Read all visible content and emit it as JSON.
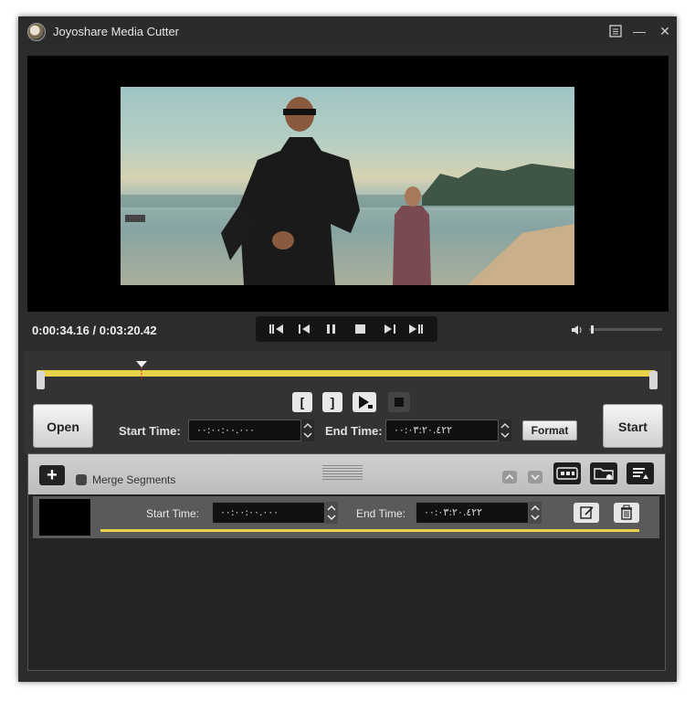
{
  "window": {
    "title": "Joyoshare Media Cutter"
  },
  "titlebar": {
    "icons": [
      "menu-icon",
      "minimize-icon",
      "close-icon"
    ],
    "minimize_glyph": "—",
    "close_glyph": "✕"
  },
  "player": {
    "current_time": "0:00:34.16",
    "total_time": "0:03:20.42",
    "time_separator": " / ",
    "playback_buttons": [
      "frame-back-icon",
      "step-back-icon",
      "pause-icon",
      "stop-icon",
      "step-forward-icon",
      "frame-forward-icon"
    ],
    "volume_level": 0.02
  },
  "editor": {
    "playhead_fraction": 0.17,
    "mark_start": "[",
    "mark_end": "]",
    "open_label": "Open",
    "start_label": "Start",
    "start_time_label": "Start Time:",
    "start_time_value": "٠٠:٠٠:٠٠.٠٠٠",
    "end_time_label": "End Time:",
    "end_time_value": "٠٠:٠٣:٢٠.٤٢٢",
    "format_label": "Format"
  },
  "segments": {
    "add_glyph": "+",
    "merge_label": "Merge Segments",
    "toolbar_icons": [
      "move-up-icon",
      "move-down-icon",
      "subtitle-icon",
      "folder-icon",
      "list-icon"
    ],
    "items": [
      {
        "start_time_label": "Start Time:",
        "start_time_value": "٠٠:٠٠:٠٠.٠٠٠",
        "end_time_label": "End Time:",
        "end_time_value": "٠٠:٠٣:٢٠.٤٢٢",
        "progress": 1.0
      }
    ]
  },
  "colors": {
    "accent": "#e8d24a",
    "panel": "#333333",
    "background": "#2c2c2c"
  }
}
